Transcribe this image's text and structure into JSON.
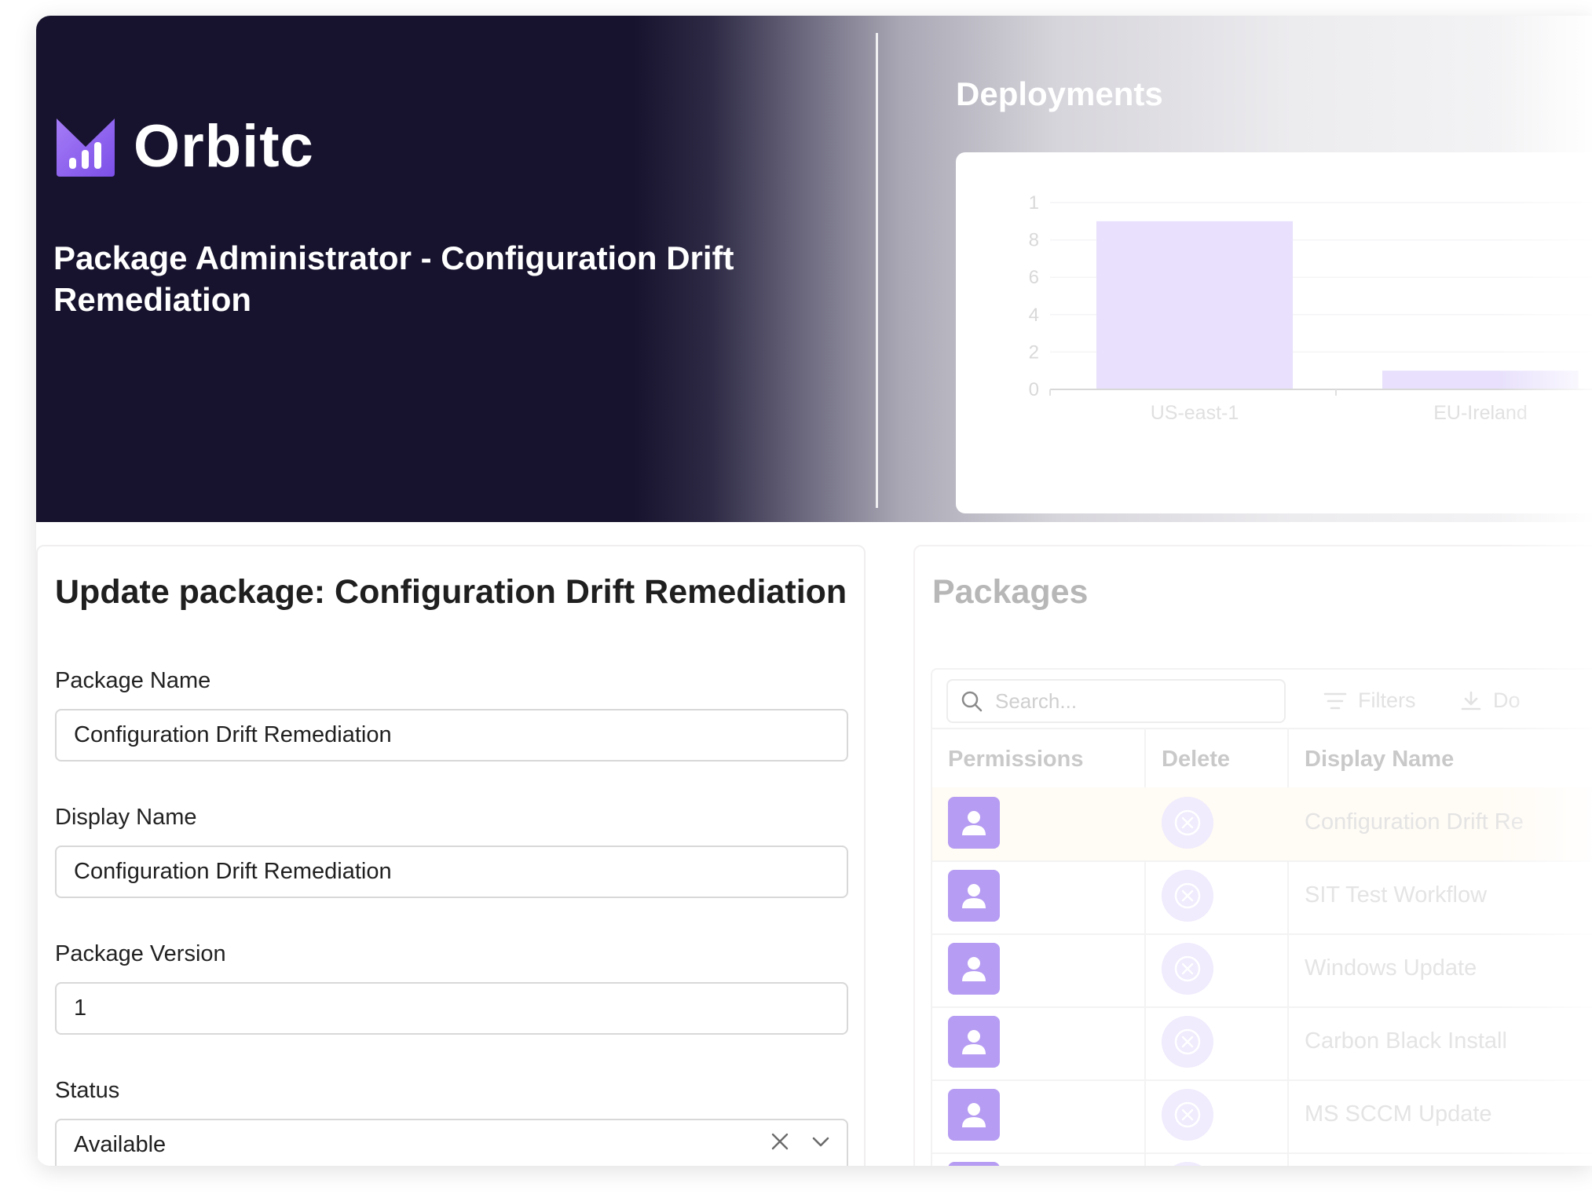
{
  "brand": {
    "name": "Orbitc",
    "logo_color": "#8b5cf6"
  },
  "hero": {
    "title": "Package Administrator - Configuration Drift Remediation"
  },
  "deployments": {
    "title": "Deployments"
  },
  "chart_data": {
    "type": "bar",
    "categories": [
      "US-east-1",
      "EU-Ireland"
    ],
    "values": [
      0.9,
      0.1
    ],
    "ylim": [
      0,
      1
    ],
    "yticks": [
      "0",
      "2",
      "4",
      "6",
      "8",
      "1"
    ],
    "bar_color": "#e8e0fc"
  },
  "form": {
    "heading": "Update package: Configuration Drift Remediation",
    "package_name_label": "Package Name",
    "package_name_value": "Configuration Drift Remediation",
    "display_name_label": "Display Name",
    "display_name_value": "Configuration Drift Remediation",
    "package_version_label": "Package Version",
    "package_version_value": "1",
    "status_label": "Status",
    "status_value": "Available"
  },
  "packages": {
    "title": "Packages",
    "search_placeholder": "Search...",
    "filters_label": "Filters",
    "download_label": "Do",
    "columns": [
      "Permissions",
      "Delete",
      "Display Name"
    ],
    "rows": [
      {
        "display_name": "Configuration Drift Re"
      },
      {
        "display_name": "SIT Test Workflow"
      },
      {
        "display_name": "Windows Update"
      },
      {
        "display_name": "Carbon Black Install"
      },
      {
        "display_name": "MS SCCM Update"
      }
    ]
  },
  "colors": {
    "hero_bg": "#17132e",
    "accent": "#b69cf2"
  }
}
